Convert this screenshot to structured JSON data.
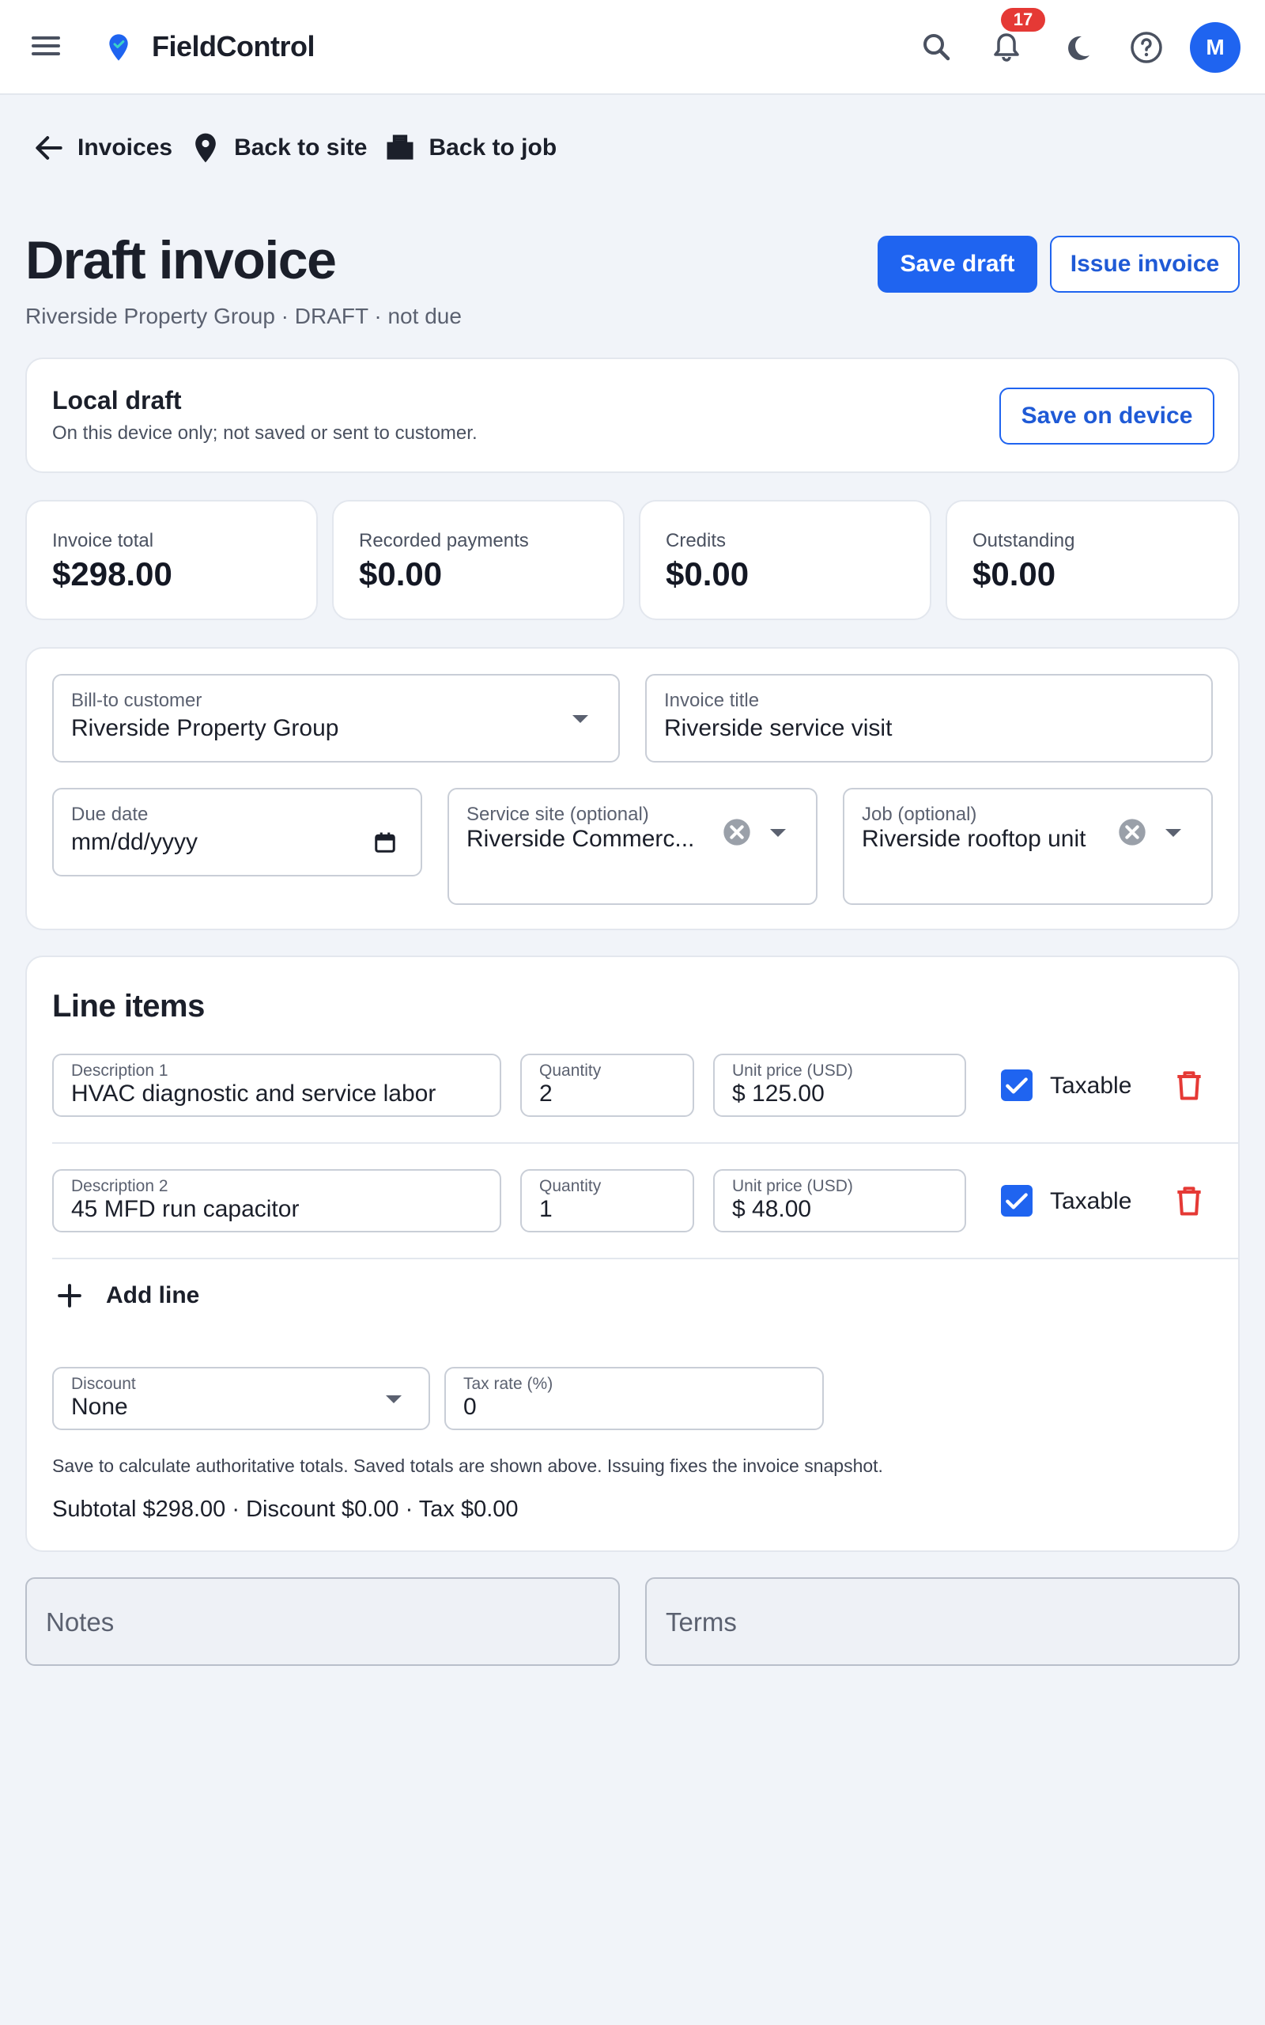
{
  "app": {
    "brand": "FieldControl",
    "notification_count": "17",
    "avatar_initial": "M",
    "accent_color": "#1f64f0",
    "danger_color": "#e53935",
    "icons": [
      "menu-icon",
      "location-pin-icon",
      "search-icon",
      "bell-icon",
      "moon-icon",
      "help-icon"
    ]
  },
  "breadcrumbs": {
    "invoices": "Invoices",
    "back_to_site": "Back to site",
    "back_to_job": "Back to job"
  },
  "header": {
    "title": "Draft invoice",
    "subtitle": "Riverside Property Group · DRAFT · not due",
    "save_draft": "Save draft",
    "issue_invoice": "Issue invoice"
  },
  "local_draft": {
    "title": "Local draft",
    "description": "On this device only; not saved or sent to customer.",
    "save_on_device": "Save on device"
  },
  "stats": [
    {
      "label": "Invoice total",
      "value": "$298.00"
    },
    {
      "label": "Recorded payments",
      "value": "$0.00"
    },
    {
      "label": "Credits",
      "value": "$0.00"
    },
    {
      "label": "Outstanding",
      "value": "$0.00"
    }
  ],
  "form": {
    "bill_to": {
      "label": "Bill-to customer",
      "value": "Riverside Property Group"
    },
    "invoice_title": {
      "label": "Invoice title",
      "value": "Riverside service visit"
    },
    "due_date": {
      "label": "Due date",
      "value": "mm/dd/yyyy"
    },
    "service_site": {
      "label": "Service site (optional)",
      "value": "Riverside Commerc..."
    },
    "job": {
      "label": "Job (optional)",
      "value": "Riverside rooftop unit"
    }
  },
  "line_items": {
    "heading": "Line items",
    "items": [
      {
        "description_label": "Description 1",
        "description": "HVAC diagnostic and service labor",
        "quantity_label": "Quantity",
        "quantity": "2",
        "price_label": "Unit price (USD)",
        "price": "$ 125.00",
        "taxable": true,
        "taxable_label": "Taxable"
      },
      {
        "description_label": "Description 2",
        "description": "45 MFD run capacitor",
        "quantity_label": "Quantity",
        "quantity": "1",
        "price_label": "Unit price (USD)",
        "price": "$ 48.00",
        "taxable": true,
        "taxable_label": "Taxable"
      }
    ],
    "add_line": "Add line",
    "discount": {
      "label": "Discount",
      "value": "None"
    },
    "tax_rate": {
      "label": "Tax rate (%)",
      "value": "0"
    },
    "note": "Save to calculate authoritative totals. Saved totals are shown above. Issuing fixes the invoice snapshot.",
    "totals": "Subtotal $298.00 · Discount $0.00 · Tax $0.00"
  },
  "notes": {
    "placeholder": "Notes"
  },
  "terms": {
    "placeholder": "Terms"
  }
}
